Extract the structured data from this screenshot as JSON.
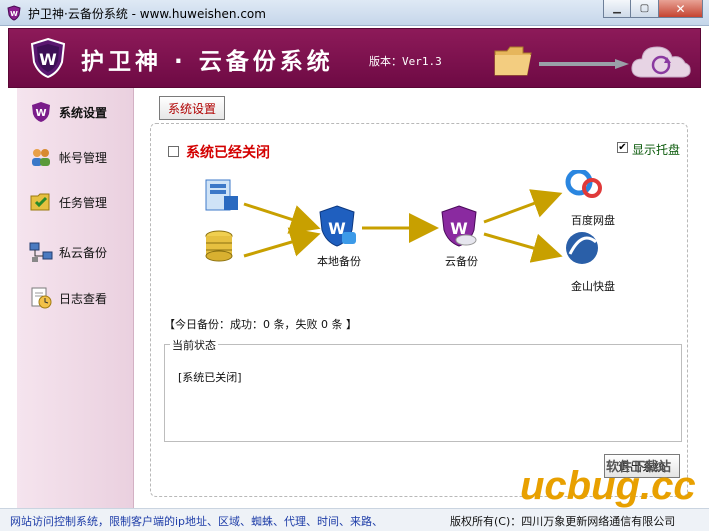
{
  "window": {
    "title": "护卫神·云备份系统 - www.huweishen.com"
  },
  "header": {
    "title": "护卫神 · 云备份系统",
    "version": "版本：Ver1.3"
  },
  "sidebar": {
    "items": [
      {
        "label": "系统设置",
        "icon": "settings-shield-icon",
        "active": true
      },
      {
        "label": "帐号管理",
        "icon": "users-icon",
        "active": false
      },
      {
        "label": "任务管理",
        "icon": "task-folder-icon",
        "active": false
      },
      {
        "label": "私云备份",
        "icon": "network-computer-icon",
        "active": false
      },
      {
        "label": "日志查看",
        "icon": "log-clock-icon",
        "active": false
      }
    ]
  },
  "main": {
    "tab_label": "系统设置",
    "status_title": "系统已经关闭",
    "show_tray_label": "显示托盘",
    "show_tray_checked": true,
    "system_closed_checked": false,
    "flow": {
      "local_backup": "本地备份",
      "cloud_backup": "云备份",
      "baidu": "百度网盘",
      "kingsoft": "金山快盘"
    },
    "today_backup": "【今日备份：成功：0 条，失败 0 条 】",
    "current_status_legend": "当前状态",
    "current_status_text": "[系统已关闭]",
    "exit_button": "退出系统"
  },
  "statusbar": {
    "ad_text": "网站访问控制系统，限制客户端的ip地址、区域、蜘蛛、代理、时间、来路、",
    "copyright": "版权所有(C)：四川万象更新网络通信有限公司"
  },
  "watermark": {
    "brand": "ucbug.cc",
    "sub": "软件下载站"
  },
  "colors": {
    "banner": "#7e1150",
    "accent_red": "#d30000",
    "arrow": "#c8a000"
  }
}
